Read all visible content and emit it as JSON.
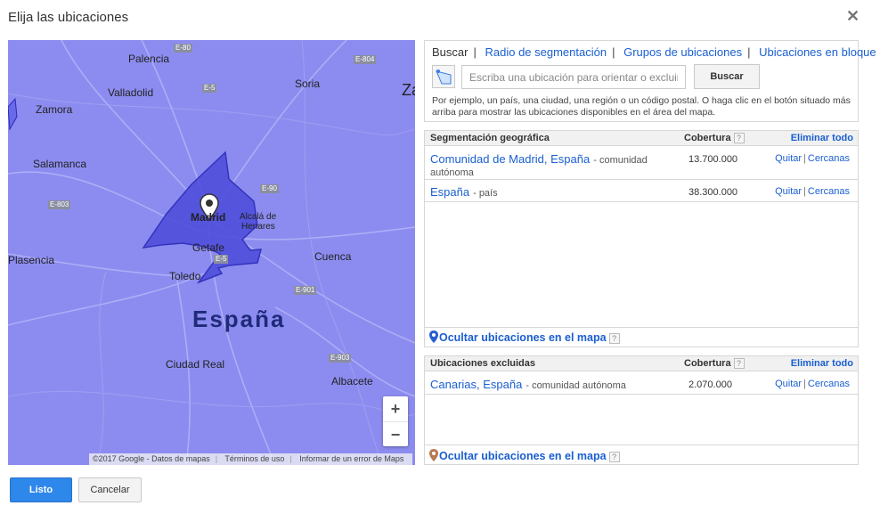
{
  "dialog": {
    "title": "Elija las ubicaciones",
    "close_glyph": "✕"
  },
  "map": {
    "country_label": "España",
    "cities": [
      {
        "name": "Palencia"
      },
      {
        "name": "Valladolid"
      },
      {
        "name": "Soria"
      },
      {
        "name": "Zamora"
      },
      {
        "name": "Salamanca"
      },
      {
        "name": "Madrid"
      },
      {
        "name": "Alcalá de"
      },
      {
        "name": "Henares"
      },
      {
        "name": "Getafe"
      },
      {
        "name": "Plasencia"
      },
      {
        "name": "Toledo"
      },
      {
        "name": "Cuenca"
      },
      {
        "name": "Ciudad Real"
      },
      {
        "name": "Albacete"
      },
      {
        "name": "Za"
      }
    ],
    "roads": [
      "E-80",
      "E-804",
      "E-5",
      "E-90",
      "E-803",
      "E-5",
      "E-901",
      "E-903"
    ],
    "zoom_in": "+",
    "zoom_out": "−",
    "footer": {
      "copyright": "©2017 Google - Datos de mapas",
      "terms": "Términos de uso",
      "report": "Informar de un error de Maps"
    },
    "colors": {
      "overlay": "#8c8cf0",
      "selected_region": "#4f4fdc",
      "region_stroke": "#2a2ab8"
    }
  },
  "search_panel": {
    "tabs": [
      "Buscar",
      "Radio de segmentación",
      "Grupos de ubicaciones",
      "Ubicaciones en bloque"
    ],
    "separator": "|",
    "input_placeholder": "Escriba una ubicación para orientar o excluir",
    "input_value": "",
    "search_button": "Buscar",
    "hint": "Por ejemplo, un país, una ciudad, una región o un código postal. O haga clic en el botón situado más arriba para mostrar las ubicaciones disponibles en el área del mapa."
  },
  "geo_targeting": {
    "header": "Segmentación geográfica",
    "coverage_header": "Cobertura",
    "help": "?",
    "clear_all": "Eliminar todo",
    "rows": [
      {
        "name": "Comunidad de Madrid, España",
        "type_line1": "- comunidad",
        "type_line2": "autónoma",
        "coverage": "13.700.000",
        "remove": "Quitar",
        "nearby": "Cercanas"
      },
      {
        "name": "España",
        "type_line1": "- país",
        "coverage": "38.300.000",
        "remove": "Quitar",
        "nearby": "Cercanas"
      }
    ],
    "hide_locations": "Ocultar ubicaciones en el mapa"
  },
  "excluded": {
    "header": "Ubicaciones excluidas",
    "coverage_header": "Cobertura",
    "help": "?",
    "clear_all": "Eliminar todo",
    "rows": [
      {
        "name": "Canarias, España",
        "type_line1": "- comunidad autónoma",
        "coverage": "2.070.000",
        "remove": "Quitar",
        "nearby": "Cercanas"
      }
    ],
    "hide_locations": "Ocultar ubicaciones en el mapa"
  },
  "footer_buttons": {
    "done": "Listo",
    "cancel": "Cancelar"
  },
  "action_separator": "|"
}
